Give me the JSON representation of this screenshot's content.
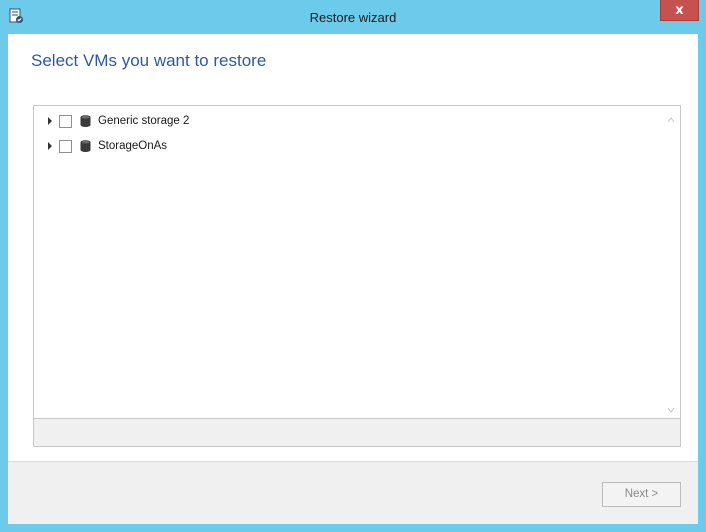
{
  "window": {
    "title": "Restore wizard",
    "close_label": "x"
  },
  "page": {
    "heading": "Select VMs you want to restore"
  },
  "tree": {
    "nodes": [
      {
        "label": "Generic storage 2",
        "icon": "database-icon",
        "checked": false,
        "expanded": false
      },
      {
        "label": "StorageOnAs",
        "icon": "database-icon",
        "checked": false,
        "expanded": false
      }
    ]
  },
  "footer": {
    "next_label": "Next >",
    "next_enabled": false
  },
  "colors": {
    "frame": "#6ccbeb",
    "heading": "#2c5aa0",
    "close": "#c75050",
    "footer_bg": "#f0f0f0"
  }
}
